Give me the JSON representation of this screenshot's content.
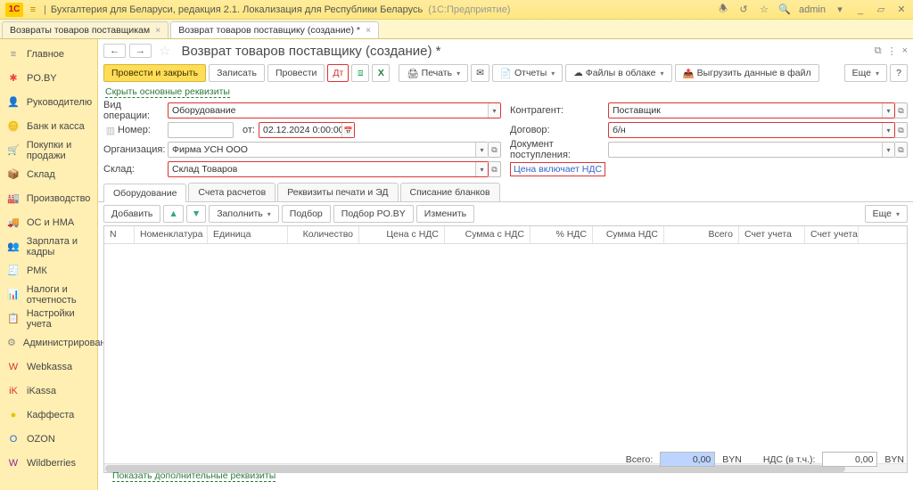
{
  "titlebar": {
    "menu_icon": "≡",
    "config": "Бухгалтерия для Беларуси, редакция 2.1. Локализация для Республики Беларусь",
    "mode": "(1С:Предприятие)",
    "user": "admin",
    "icons": {
      "bell": "🕭",
      "history": "↺",
      "star": "☆",
      "search": "🔍",
      "underscore": "_",
      "window": "▱",
      "close": "✕",
      "dropdown": "▾"
    }
  },
  "persp_tabs": [
    {
      "label": "Возвраты товаров поставщикам",
      "closable": true,
      "active": false
    },
    {
      "label": "Возврат товаров поставщику (создание) *",
      "closable": true,
      "active": true
    }
  ],
  "sidebar": [
    {
      "icon": "≡",
      "label": "Главное"
    },
    {
      "icon": "✱",
      "label": "PO.BY",
      "active": true,
      "color": "#e44"
    },
    {
      "icon": "👤",
      "label": "Руководителю",
      "color": "#e77"
    },
    {
      "icon": "🪙",
      "label": "Банк и касса",
      "color": "#caa24a"
    },
    {
      "icon": "🛒",
      "label": "Покупки и продажи",
      "color": "#a33"
    },
    {
      "icon": "📦",
      "label": "Склад",
      "color": "#5a8"
    },
    {
      "icon": "🏭",
      "label": "Производство",
      "color": "#5b6"
    },
    {
      "icon": "🚚",
      "label": "ОС и НМА",
      "color": "#777"
    },
    {
      "icon": "👥",
      "label": "Зарплата и кадры",
      "color": "#c88"
    },
    {
      "icon": "🧾",
      "label": "РМК",
      "color": "#d55"
    },
    {
      "icon": "📊",
      "label": "Налоги и отчетность",
      "color": "#6aa"
    },
    {
      "icon": "📋",
      "label": "Настройки учета",
      "color": "#888"
    },
    {
      "icon": "⚙",
      "label": "Администрирование",
      "color": "#888"
    },
    {
      "icon": "W",
      "label": "Webkassa",
      "color": "#d33"
    },
    {
      "icon": "iK",
      "label": "iKassa",
      "color": "#d33"
    },
    {
      "icon": "●",
      "label": "Каффеста",
      "color": "#e5c400"
    },
    {
      "icon": "O",
      "label": "OZON",
      "color": "#2a6bd4"
    },
    {
      "icon": "W",
      "label": "Wildberries",
      "color": "#8a2596"
    }
  ],
  "doc": {
    "title": "Возврат товаров поставщику (создание) *",
    "nav_back": "←",
    "nav_fwd": "→",
    "star": "☆",
    "toolbar": {
      "post_close": "Провести и закрыть",
      "write": "Записать",
      "post": "Провести",
      "print": "Печать",
      "reports": "Отчеты",
      "cloud": "Файлы в облаке",
      "export": "Выгрузить данные в файл",
      "more": "Еще",
      "help": "?"
    },
    "hide_req": "Скрыть основные реквизиты",
    "left_form": {
      "op_label": "Вид операции:",
      "op_value": "Оборудование",
      "num_label": "Номер:",
      "num_value": "",
      "date_label": "от:",
      "date_value": "02.12.2024   0:00:00",
      "org_label": "Организация:",
      "org_value": "Фирма УСН ООО",
      "wh_label": "Склад:",
      "wh_value": "Склад Товаров"
    },
    "right_form": {
      "ctr_label": "Контрагент:",
      "ctr_value": "Поставщик",
      "dog_label": "Договор:",
      "dog_value": "б/н",
      "doc_label": "Документ поступления:",
      "nds_link": "Цена включает НДС"
    },
    "subtabs": [
      "Оборудование",
      "Счета расчетов",
      "Реквизиты печати и ЭД",
      "Списание бланков"
    ],
    "grid_tb": {
      "add": "Добавить",
      "fill": "Заполнить",
      "pick": "Подбор",
      "pickpo": "Подбор PO.BY",
      "edit": "Изменить",
      "more": "Еще"
    },
    "columns": [
      "N",
      "Номенклатура",
      "Единица",
      "Количество",
      "Цена с НДС",
      "Сумма с НДС",
      "% НДС",
      "Сумма НДС",
      "Всего",
      "Счет учета",
      "Счет учета НДС"
    ],
    "totals": {
      "label": "Всего:",
      "v1": "0,00",
      "cur": "BYN",
      "nds_lbl": "НДС (в т.ч.):",
      "v2": "0,00"
    },
    "extra_link": "Показать дополнительные реквизиты"
  }
}
